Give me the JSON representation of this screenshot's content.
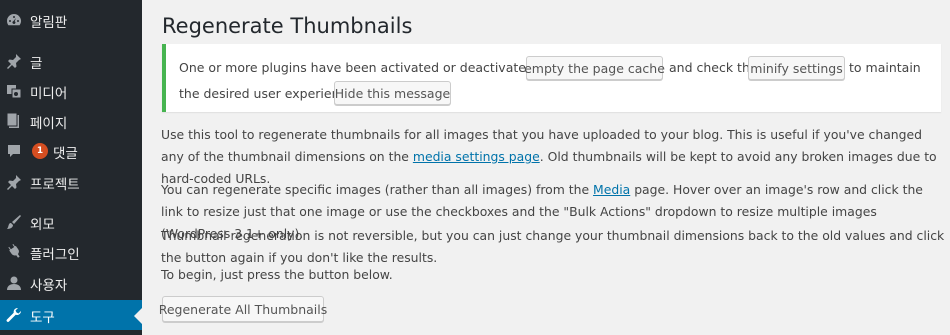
{
  "sidebar": {
    "items": [
      {
        "label": "알림판",
        "icon": "dashboard-icon"
      },
      {
        "label": "글",
        "icon": "pin-icon"
      },
      {
        "label": "미디어",
        "icon": "media-icon"
      },
      {
        "label": "페이지",
        "icon": "page-icon"
      },
      {
        "label": "댓글",
        "icon": "comment-icon",
        "badge": "1"
      },
      {
        "label": "프로젝트",
        "icon": "pin-icon"
      },
      {
        "label": "외모",
        "icon": "brush-icon"
      },
      {
        "label": "플러그인",
        "icon": "plug-icon"
      },
      {
        "label": "사용자",
        "icon": "user-icon"
      },
      {
        "label": "도구",
        "icon": "wrench-icon",
        "current": true
      }
    ]
  },
  "page": {
    "title": "Regenerate Thumbnails"
  },
  "notice": {
    "text_before": "One or more plugins have been activated or deactivated, please",
    "btn_cache": "empty the page cache",
    "text_middle": "and check the",
    "btn_minify": "minify settings",
    "text_after": "to maintain",
    "text_line2": "the desired user experience.",
    "btn_hide": "Hide this message"
  },
  "content": {
    "p1_a": "Use this tool to regenerate thumbnails for all images that you have uploaded to your blog. This is useful if you've changed any of the thumbnail dimensions on the ",
    "p1_link": "media settings page",
    "p1_b": ". Old thumbnails will be kept to avoid any broken images due to hard-coded URLs.",
    "p2_a": "You can regenerate specific images (rather than all images) from the ",
    "p2_link": "Media",
    "p2_b": " page. Hover over an image's row and click the link to resize just that one image or use the checkboxes and the \"Bulk Actions\" dropdown to resize multiple images (WordPress 3.1+ only).",
    "p3": "Thumbnail regeneration is not reversible, but you can just change your thumbnail dimensions back to the old values and click the button again if you don't like the results.",
    "p4": "To begin, just press the button below.",
    "button": "Regenerate All Thumbnails"
  },
  "colors": {
    "sidebar_bg": "#23282d",
    "current_bg": "#0073aa",
    "notice_border": "#46b450",
    "badge_bg": "#d54e21",
    "link": "#0073aa"
  }
}
